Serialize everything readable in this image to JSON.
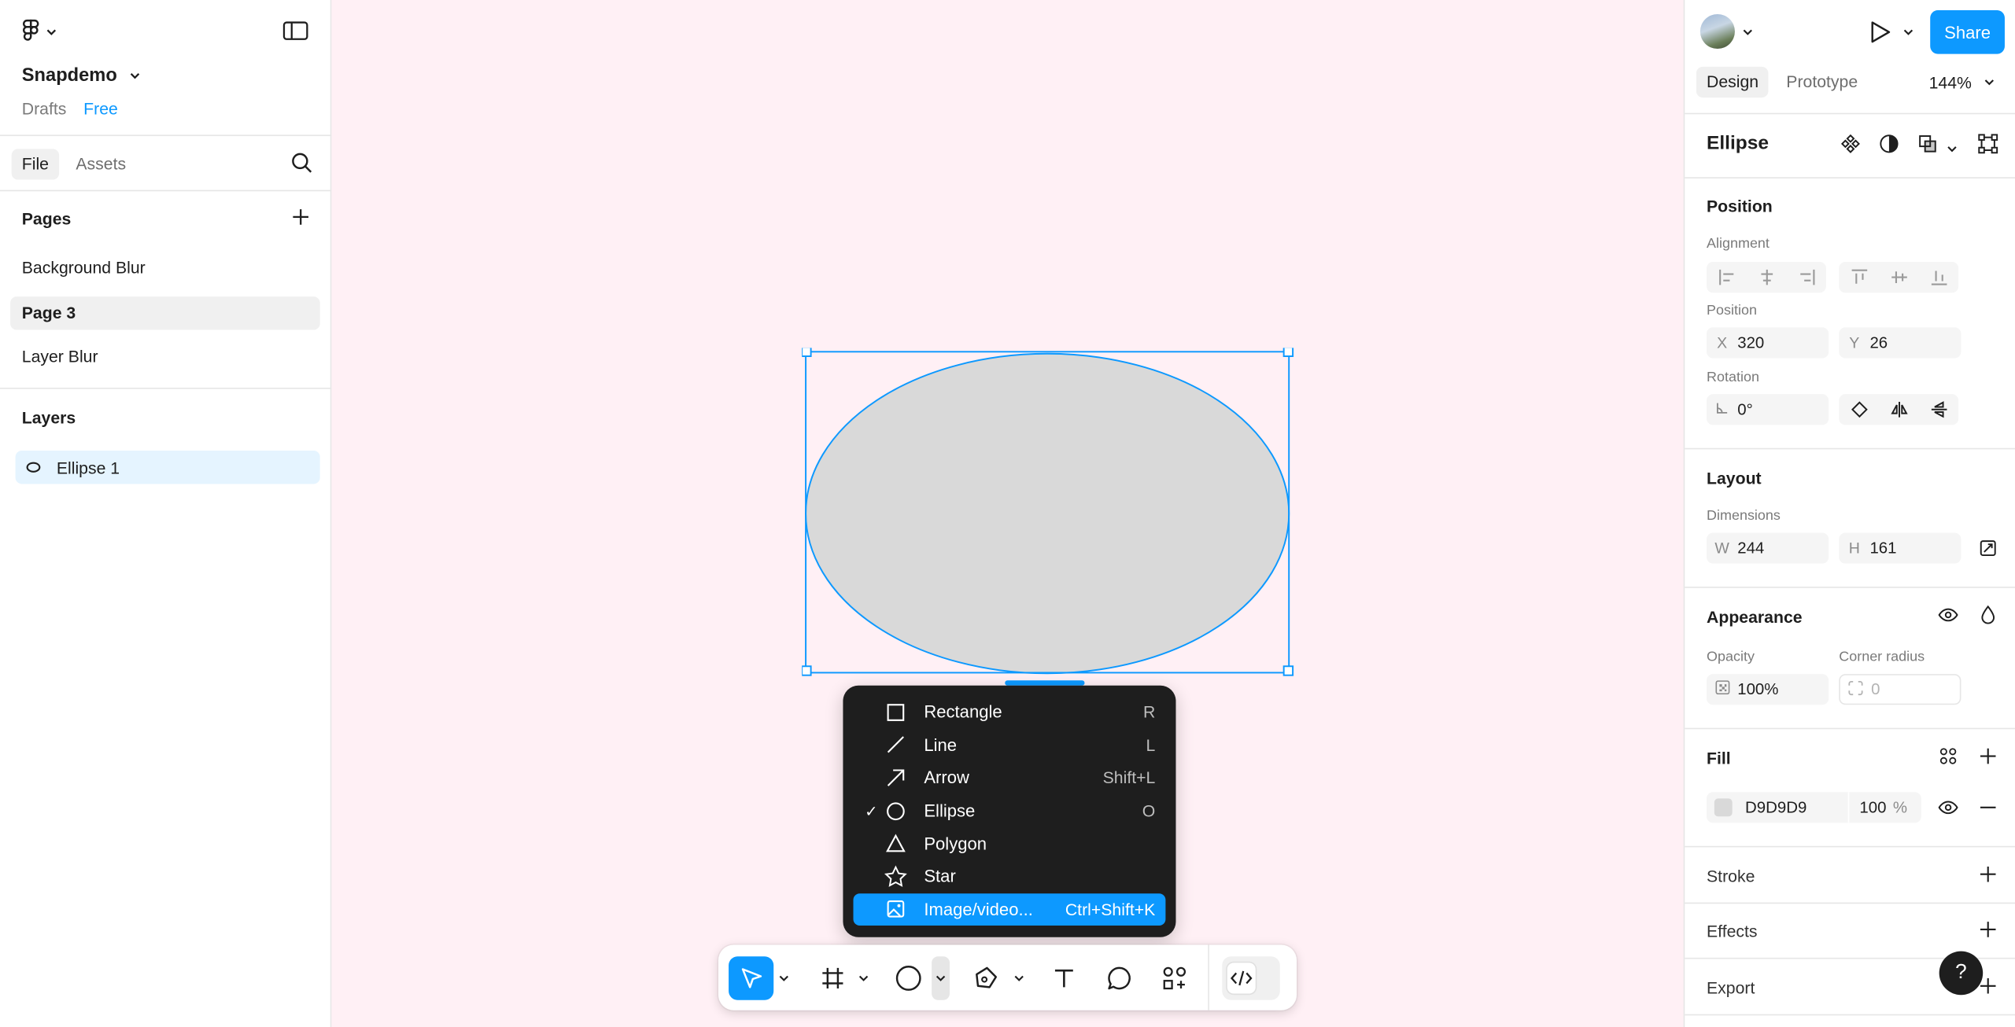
{
  "project": {
    "name": "Snapdemo",
    "location": "Drafts",
    "plan": "Free"
  },
  "left_tabs": {
    "file": "File",
    "assets": "Assets"
  },
  "pages": {
    "title": "Pages",
    "items": [
      {
        "label": "Background Blur",
        "active": false
      },
      {
        "label": "Page 3",
        "active": true
      },
      {
        "label": "Layer Blur",
        "active": false
      }
    ]
  },
  "layers": {
    "title": "Layers",
    "items": [
      {
        "label": "Ellipse 1",
        "icon": "ellipse-icon",
        "selected": true
      }
    ]
  },
  "canvas": {
    "background": "#fff0f5",
    "selection_color": "#0d99ff",
    "ellipse_fill": "#D9D9D9"
  },
  "shape_menu": {
    "items": [
      {
        "label": "Rectangle",
        "shortcut": "R",
        "icon": "rectangle-icon",
        "checked": false,
        "highlighted": false
      },
      {
        "label": "Line",
        "shortcut": "L",
        "icon": "line-icon",
        "checked": false,
        "highlighted": false
      },
      {
        "label": "Arrow",
        "shortcut": "Shift+L",
        "icon": "arrow-icon",
        "checked": false,
        "highlighted": false
      },
      {
        "label": "Ellipse",
        "shortcut": "O",
        "icon": "ellipse-icon",
        "checked": true,
        "highlighted": false
      },
      {
        "label": "Polygon",
        "shortcut": "",
        "icon": "polygon-icon",
        "checked": false,
        "highlighted": false
      },
      {
        "label": "Star",
        "shortcut": "",
        "icon": "star-icon",
        "checked": false,
        "highlighted": false
      },
      {
        "label": "Image/video...",
        "shortcut": "Ctrl+Shift+K",
        "icon": "image-icon",
        "checked": false,
        "highlighted": true
      }
    ],
    "check_glyph": "✓"
  },
  "toolbar": {
    "tools": [
      "move-tool",
      "frame-tool",
      "ellipse-tool",
      "pen-tool",
      "text-tool",
      "comment-tool",
      "actions-tool",
      "dev-mode-toggle"
    ],
    "active_tool": "move-tool"
  },
  "right_panel": {
    "share_label": "Share",
    "tabs": {
      "design": "Design",
      "prototype": "Prototype"
    },
    "zoom": "144%",
    "layer_type": "Ellipse",
    "position": {
      "title": "Position",
      "alignment_label": "Alignment",
      "position_label": "Position",
      "x_prefix": "X",
      "x": "320",
      "y_prefix": "Y",
      "y": "26",
      "rotation_label": "Rotation",
      "rotation": "0°"
    },
    "layout": {
      "title": "Layout",
      "dimensions_label": "Dimensions",
      "w_prefix": "W",
      "w": "244",
      "h_prefix": "H",
      "h": "161"
    },
    "appearance": {
      "title": "Appearance",
      "opacity_label": "Opacity",
      "opacity": "100%",
      "radius_label": "Corner radius",
      "radius": "0"
    },
    "fill": {
      "title": "Fill",
      "hex": "D9D9D9",
      "opacity": "100",
      "percent": "%"
    },
    "stroke": {
      "title": "Stroke"
    },
    "effects": {
      "title": "Effects"
    },
    "export": {
      "title": "Export"
    },
    "help": "?"
  }
}
